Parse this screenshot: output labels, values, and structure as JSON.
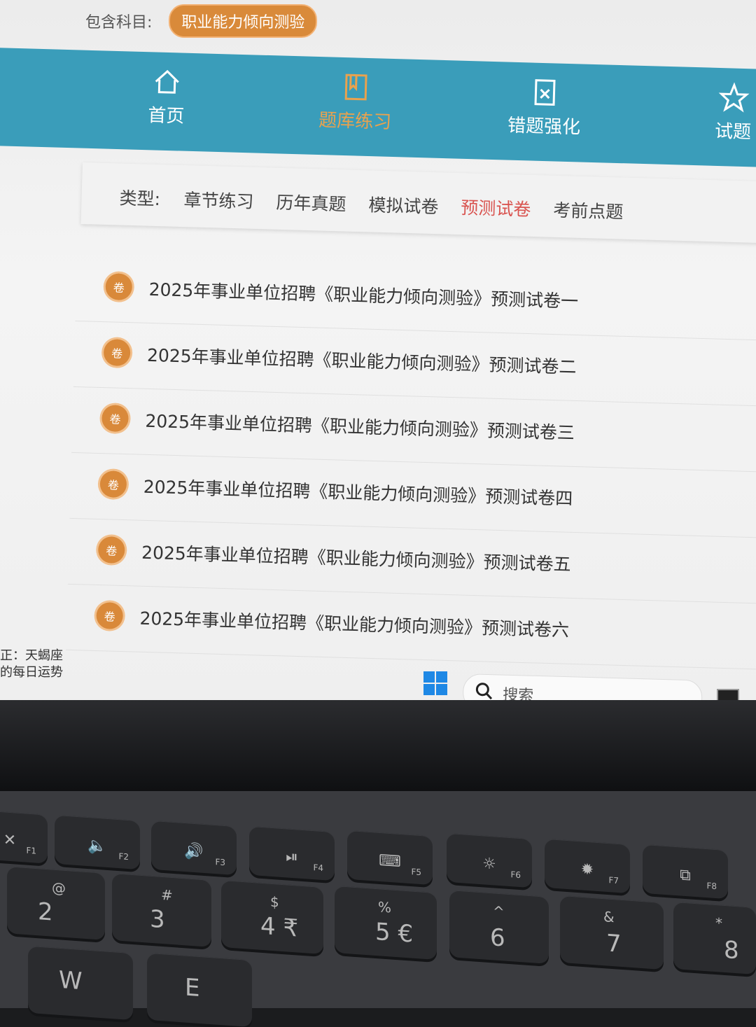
{
  "subject": {
    "label": "包含科目:",
    "selected": "职业能力倾向测验"
  },
  "nav": {
    "items": [
      {
        "label": "首页",
        "icon": "home-icon",
        "active": false
      },
      {
        "label": "题库练习",
        "icon": "book-icon",
        "active": true
      },
      {
        "label": "错题强化",
        "icon": "wrong-question-icon",
        "active": false
      },
      {
        "label": "试题",
        "icon": "star-icon",
        "active": false
      }
    ]
  },
  "types": {
    "label": "类型:",
    "items": [
      "章节练习",
      "历年真题",
      "模拟试卷",
      "预测试卷",
      "考前点题"
    ],
    "active_index": 3
  },
  "papers": {
    "badge": "卷",
    "items": [
      "2025年事业单位招聘《职业能力倾向测验》预测试卷一",
      "2025年事业单位招聘《职业能力倾向测验》预测试卷二",
      "2025年事业单位招聘《职业能力倾向测验》预测试卷三",
      "2025年事业单位招聘《职业能力倾向测验》预测试卷四",
      "2025年事业单位招聘《职业能力倾向测验》预测试卷五",
      "2025年事业单位招聘《职业能力倾向测验》预测试卷六"
    ]
  },
  "taskbar": {
    "news_line1": "正：天蝎座",
    "news_line2": "的每日运势",
    "search_placeholder": "搜索"
  },
  "keyboard": {
    "fn_keys": [
      {
        "fn": "F1",
        "glyph": "✕"
      },
      {
        "fn": "F2",
        "glyph": "🔈"
      },
      {
        "fn": "F3",
        "glyph": "🔊"
      },
      {
        "fn": "F4",
        "glyph": "⏯"
      },
      {
        "fn": "F5",
        "glyph": "⌨"
      },
      {
        "fn": "F6",
        "glyph": "☼"
      },
      {
        "fn": "F7",
        "glyph": "✹"
      },
      {
        "fn": "F8",
        "glyph": "⧉"
      }
    ],
    "num_keys": [
      {
        "top": "@",
        "main": "2"
      },
      {
        "top": "#",
        "main": "3"
      },
      {
        "top": "$",
        "main": "4 ₹"
      },
      {
        "top": "%",
        "main": "5 €"
      },
      {
        "top": "^",
        "main": "6"
      },
      {
        "top": "&",
        "main": "7"
      },
      {
        "top": "*",
        "main": "8"
      }
    ],
    "letter_keys": [
      "W",
      "E"
    ]
  },
  "colors": {
    "nav_bg": "#3a9dba",
    "accent_orange": "#d9893a",
    "active_red": "#d9534f"
  }
}
